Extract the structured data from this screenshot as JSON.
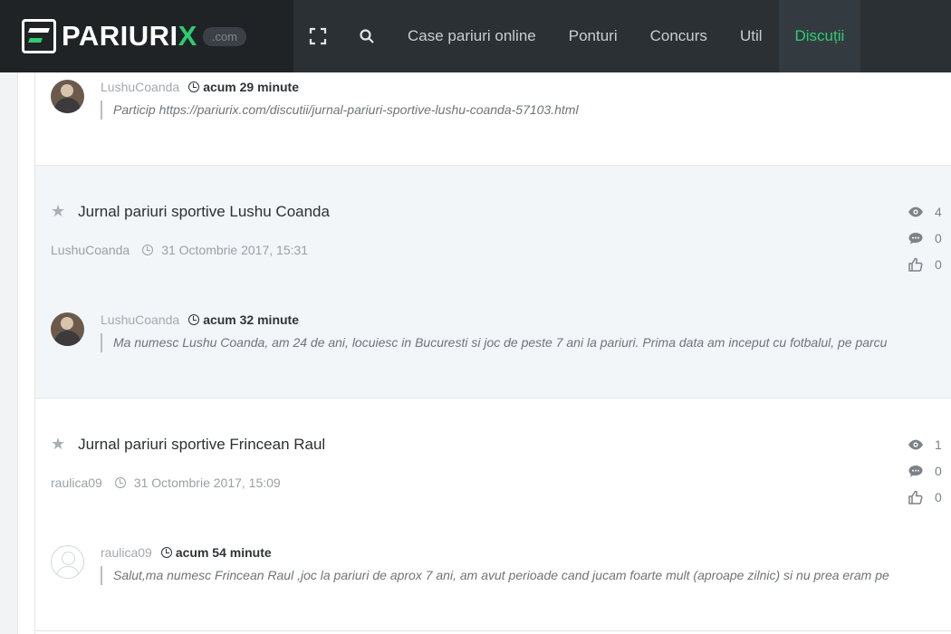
{
  "header": {
    "logo_main": "PARIURI",
    "logo_x": "X",
    "logo_domain": ".com",
    "nav": [
      {
        "label": "Case pariuri online"
      },
      {
        "label": "Ponturi"
      },
      {
        "label": "Concurs"
      },
      {
        "label": "Util"
      },
      {
        "label": "Discuții"
      }
    ]
  },
  "posts": [
    {
      "author": "LushuCoanda",
      "time": "acum 29 minute",
      "text": "Particip https://pariurix.com/discutii/jurnal-pariuri-sportive-lushu-coanda-57103.html",
      "avatar": "photo"
    }
  ],
  "topics": [
    {
      "title": "Jurnal pariuri sportive Lushu Coanda",
      "author": "LushuCoanda",
      "date": "31 Octombrie 2017, 15:31",
      "views": "4",
      "comments": "0",
      "likes": "0",
      "last_post": {
        "author": "LushuCoanda",
        "time": "acum 32 minute",
        "text": "Ma numesc Lushu Coanda, am 24 de ani, locuiesc in Bucuresti si joc de peste 7 ani la pariuri. Prima data am inceput cu fotbalul, pe parcu",
        "avatar": "photo"
      }
    },
    {
      "title": "Jurnal pariuri sportive Frincean Raul",
      "author": "raulica09",
      "date": "31 Octombrie 2017, 15:09",
      "views": "1",
      "comments": "0",
      "likes": "0",
      "last_post": {
        "author": "raulica09",
        "time": "acum 54 minute",
        "text": "Salut,ma numesc Frincean Raul ,joc la pariuri de aprox 7 ani, am avut perioade cand jucam foarte mult (aproape zilnic) si nu prea eram pe",
        "avatar": "blank"
      }
    }
  ]
}
